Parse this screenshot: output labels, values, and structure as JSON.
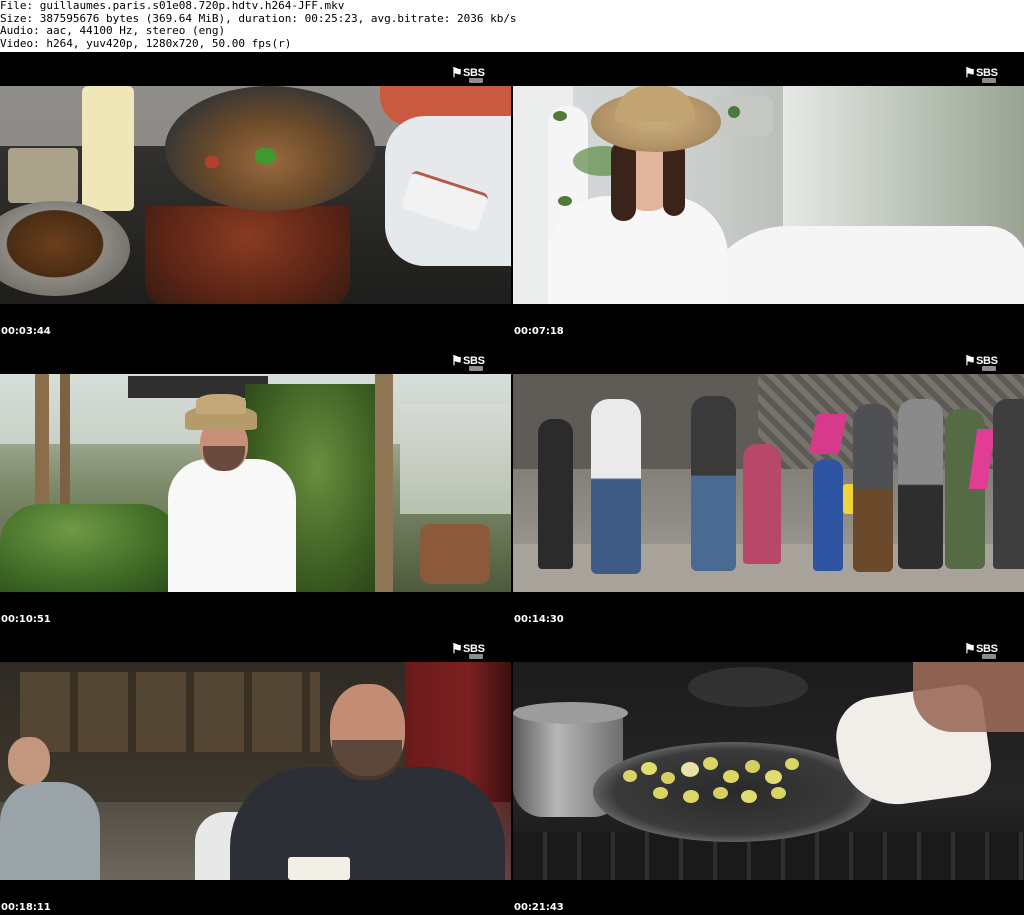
{
  "header": {
    "file_line": "File: guillaumes.paris.s01e08.720p.hdtv.h264-JFF.mkv",
    "size_line": "Size: 387595676 bytes (369.64 MiB), duration: 00:25:23, avg.bitrate: 2036 kb/s",
    "audio_line": "Audio: aac, 44100 Hz, stereo (eng)",
    "video_line": "Video: h264, yuv420p, 1280x720, 50.00 fps(r)"
  },
  "logo": {
    "mark": "⚑",
    "word": "SBS"
  },
  "thumbnails": [
    {
      "timestamp": "00:03:44"
    },
    {
      "timestamp": "00:07:18"
    },
    {
      "timestamp": "00:10:51"
    },
    {
      "timestamp": "00:14:30"
    },
    {
      "timestamp": "00:18:11"
    },
    {
      "timestamp": "00:21:43"
    }
  ]
}
